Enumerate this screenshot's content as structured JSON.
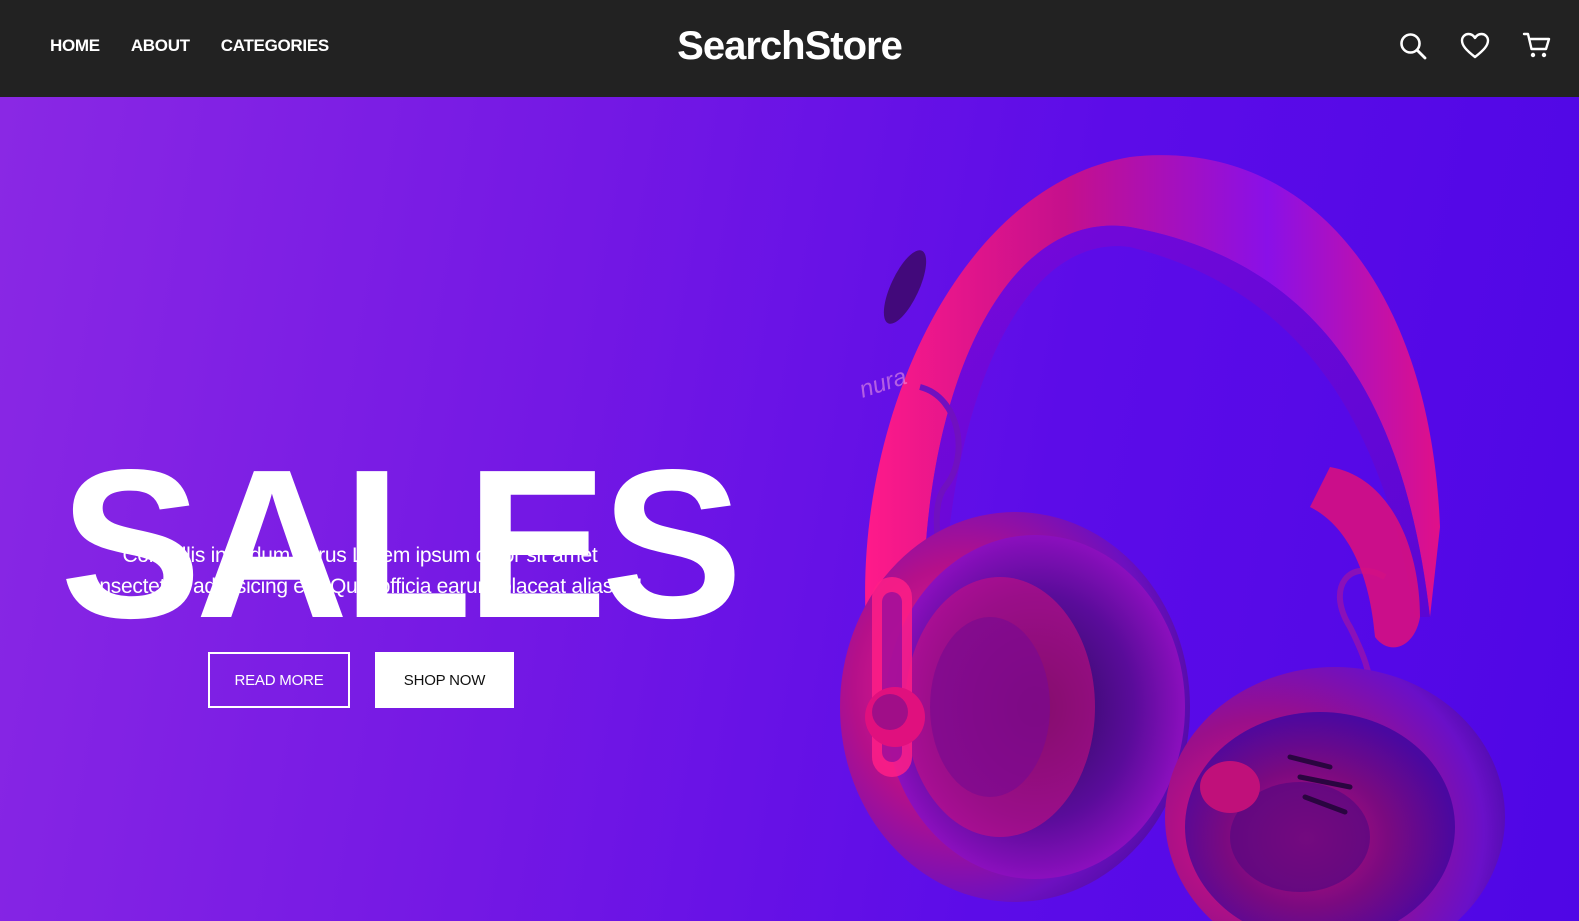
{
  "header": {
    "nav": [
      {
        "label": "HOME"
      },
      {
        "label": "ABOUT"
      },
      {
        "label": "CATEGORIES"
      }
    ],
    "brand": "SearchStore",
    "icons": [
      "search-icon",
      "heart-icon",
      "cart-icon"
    ]
  },
  "hero": {
    "title": "SALES",
    "text_line1": "Convallis interdum purus Lorem ipsum dolor sit amet",
    "text_line2": "consectetur, adipisicing elit. Quia officia earum placeat alias. A!",
    "read_more_label": "READ MORE",
    "shop_now_label": "SHOP NOW",
    "product_brand": "nura"
  },
  "colors": {
    "header_bg": "#222222",
    "hero_gradient_start": "#8a28e4",
    "hero_gradient_end": "#4f06e6",
    "product_pink": "#e0106e",
    "product_purple": "#7a10ee"
  }
}
